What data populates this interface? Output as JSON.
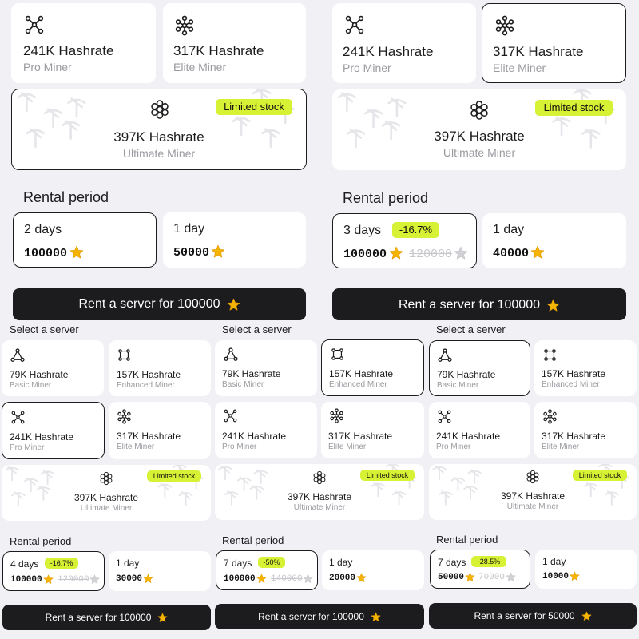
{
  "colors": {
    "accent": "#d7f234",
    "dark": "#1c1c1e",
    "star": "#f5b400",
    "muted": "#9a9aa0"
  },
  "icons": {
    "pro": "network-4-node-icon",
    "elite": "network-6-node-icon",
    "ultimate": "hexagon-cluster-icon",
    "basic": "triangle-nodes-icon",
    "enhanced": "square-nodes-icon",
    "star": "star-icon"
  },
  "panel1": {
    "pro": {
      "hashrate": "241K Hashrate",
      "tier": "Pro Miner"
    },
    "elite": {
      "hashrate": "317K Hashrate",
      "tier": "Elite Miner"
    },
    "ultimate": {
      "hashrate": "397K Hashrate",
      "tier": "Ultimate Miner",
      "badge": "Limited stock"
    },
    "rental_title": "Rental period",
    "option1": {
      "days": "2 days",
      "price": "100000"
    },
    "option2": {
      "days": "1 day",
      "price": "50000"
    },
    "button": "Rent a server for 100000"
  },
  "panel2": {
    "pro": {
      "hashrate": "241K Hashrate",
      "tier": "Pro Miner"
    },
    "elite": {
      "hashrate": "317K Hashrate",
      "tier": "Elite Miner"
    },
    "ultimate": {
      "hashrate": "397K Hashrate",
      "tier": "Ultimate Miner",
      "badge": "Limited stock"
    },
    "rental_title": "Rental period",
    "option1": {
      "days": "3 days",
      "discount": "-16.7%",
      "price": "100000",
      "old_price": "120000"
    },
    "option2": {
      "days": "1 day",
      "price": "40000"
    },
    "button": "Rent a server for 100000"
  },
  "panel3": {
    "title": "Select a server",
    "basic": {
      "hashrate": "79K Hashrate",
      "tier": "Basic Miner"
    },
    "enhanced": {
      "hashrate": "157K Hashrate",
      "tier": "Enhanced Miner"
    },
    "pro": {
      "hashrate": "241K Hashrate",
      "tier": "Pro Miner"
    },
    "elite": {
      "hashrate": "317K Hashrate",
      "tier": "Elite Miner"
    },
    "ultimate": {
      "hashrate": "397K Hashrate",
      "tier": "Ultimate Miner",
      "badge": "Limited stock"
    },
    "rental_title": "Rental period",
    "option1": {
      "days": "4 days",
      "discount": "-16.7%",
      "price": "100000",
      "old_price": "120000"
    },
    "option2": {
      "days": "1 day",
      "price": "30000"
    },
    "button": "Rent a server for 100000"
  },
  "panel4": {
    "title": "Select a server",
    "basic": {
      "hashrate": "79K Hashrate",
      "tier": "Basic Miner"
    },
    "enhanced": {
      "hashrate": "157K Hashrate",
      "tier": "Enhanced Miner"
    },
    "pro": {
      "hashrate": "241K Hashrate",
      "tier": "Pro Miner"
    },
    "elite": {
      "hashrate": "317K Hashrate",
      "tier": "Elite Miner"
    },
    "ultimate": {
      "hashrate": "397K Hashrate",
      "tier": "Ultimate Miner",
      "badge": "Limited stock"
    },
    "rental_title": "Rental period",
    "option1": {
      "days": "7 days",
      "discount": "-50%",
      "price": "100000",
      "old_price": "140000"
    },
    "option2": {
      "days": "1 day",
      "price": "20000"
    },
    "button": "Rent a server for 100000"
  },
  "panel5": {
    "title": "Select a server",
    "basic": {
      "hashrate": "79K Hashrate",
      "tier": "Basic Miner"
    },
    "enhanced": {
      "hashrate": "157K Hashrate",
      "tier": "Enhanced Miner"
    },
    "pro": {
      "hashrate": "241K Hashrate",
      "tier": "Pro Miner"
    },
    "elite": {
      "hashrate": "317K Hashrate",
      "tier": "Elite Miner"
    },
    "ultimate": {
      "hashrate": "397K Hashrate",
      "tier": "Ultimate Miner",
      "badge": "Limited stock"
    },
    "rental_title": "Rental period",
    "option1": {
      "days": "7 days",
      "discount": "-28.5%",
      "price": "50000",
      "old_price": "70000"
    },
    "option2": {
      "days": "1 day",
      "price": "10000"
    },
    "button": "Rent a server for 50000"
  }
}
